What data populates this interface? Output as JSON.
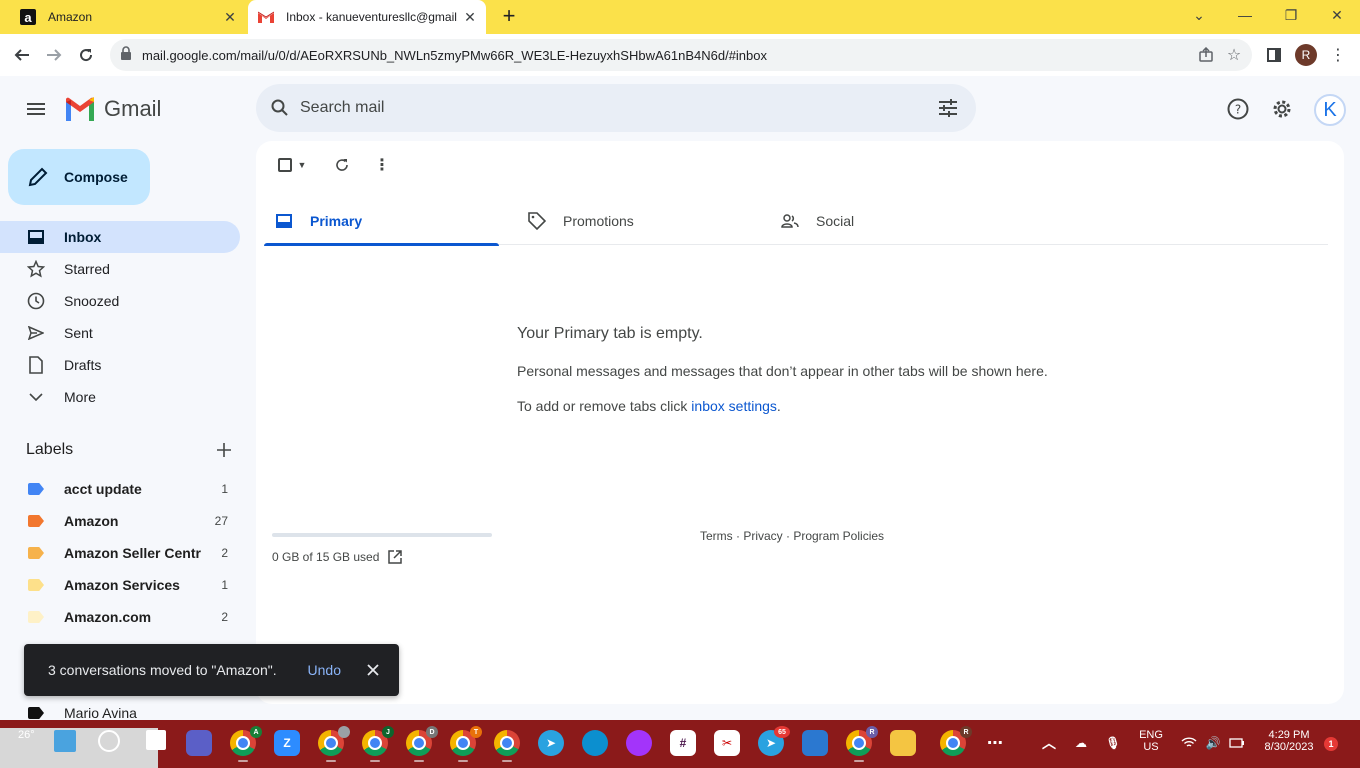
{
  "browser": {
    "tabs": [
      {
        "title": "Amazon",
        "favicon": "amazon-icon"
      },
      {
        "title": "Inbox - kanueventuresllc@gmail.com - Gmail",
        "favicon": "gmail-icon"
      }
    ],
    "url": "mail.google.com/mail/u/0/d/AEoRXRSUNb_NWLn5zmyPMw66R_WE3LE-HezuyxhSHbwA61nB4N6d/#inbox",
    "profile_initial": "R"
  },
  "gmail": {
    "logo_text": "Gmail",
    "search_placeholder": "Search mail",
    "account_initial": "K",
    "compose_label": "Compose"
  },
  "sidebar": {
    "items": [
      {
        "label": "Inbox",
        "icon": "inbox-icon",
        "selected": true
      },
      {
        "label": "Starred",
        "icon": "star-icon"
      },
      {
        "label": "Snoozed",
        "icon": "clock-icon"
      },
      {
        "label": "Sent",
        "icon": "send-icon"
      },
      {
        "label": "Drafts",
        "icon": "draft-icon"
      },
      {
        "label": "More",
        "icon": "chevron-down-icon"
      }
    ],
    "labels_heading": "Labels",
    "labels": [
      {
        "name": "acct update",
        "count": "1",
        "color": "#4285f4"
      },
      {
        "name": "Amazon",
        "count": "27",
        "color": "#f2772e"
      },
      {
        "name": "Amazon Seller Centr",
        "count": "2",
        "color": "#f6b24b"
      },
      {
        "name": "Amazon Services",
        "count": "1",
        "color": "#fde08a"
      },
      {
        "name": "Amazon.com",
        "count": "2",
        "color": "#fef1c7"
      },
      {
        "name": "Mario Avina",
        "count": "",
        "color": "#111111"
      }
    ]
  },
  "main": {
    "tabs": [
      {
        "label": "Primary",
        "icon": "inbox-tab-icon",
        "selected": true
      },
      {
        "label": "Promotions",
        "icon": "tag-icon"
      },
      {
        "label": "Social",
        "icon": "people-icon"
      }
    ],
    "empty_title": "Your Primary tab is empty.",
    "empty_line1": "Personal messages and messages that don’t appear in other tabs will be shown here.",
    "empty_line2_prefix": "To add or remove tabs click ",
    "empty_line2_link": "inbox settings",
    "empty_line2_suffix": ".",
    "storage_text": "0 GB of 15 GB used",
    "storage_fraction": 0.0,
    "footer": "Terms · Privacy · Program Policies"
  },
  "snackbar": {
    "message": "3 conversations moved to \"Amazon\".",
    "action": "Undo"
  },
  "taskbar": {
    "temperature": "26°",
    "lang_line1": "ENG",
    "lang_line2": "US",
    "time": "4:29 PM",
    "date": "8/30/2023",
    "notification_count": "1",
    "telegram_badge": "65"
  },
  "colors": {
    "tabstrip": "#fbe14a",
    "accent": "#0b57d0",
    "compose_bg": "#c2e7ff",
    "selected_nav": "#d3e3fd",
    "taskbar": "#8b1a1a"
  }
}
